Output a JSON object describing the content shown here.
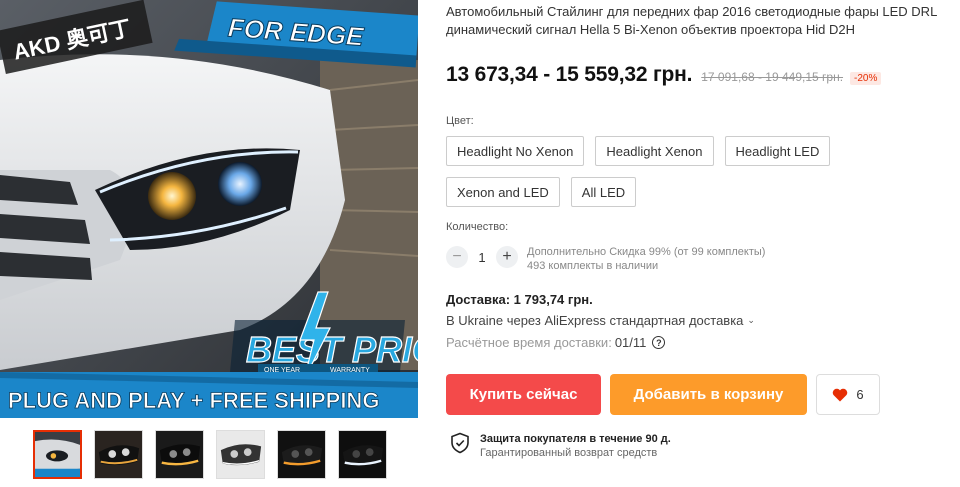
{
  "product": {
    "title": "Автомобильный Стайлинг для передних фар 2016 светодиодные фары LED DRL динамический сигнал Hella 5 Bi-Xenon объектив проектора Hid D2H",
    "price": "13 673,34 - 15 559,32 грн.",
    "old_price": "17 091,68 - 19 449,15 грн.",
    "discount": "-20%"
  },
  "image_banner": {
    "brand_text": "AKD 奥可丁",
    "top_banner": "FOR EDGE",
    "badge_main": "BEST PRICE",
    "badge_sub_left": "ONE YEAR",
    "badge_sub_right": "WARRANTY",
    "bottom_banner_1": "PLUG AND PLAY + FREE SHIPPING"
  },
  "color": {
    "label": "Цвет:",
    "options": [
      "Headlight No Xenon",
      "Headlight Xenon",
      "Headlight LED",
      "Xenon and LED",
      "All LED"
    ]
  },
  "quantity": {
    "label": "Количество:",
    "minus": "−",
    "value": "1",
    "plus": "+",
    "note_line1": "Дополнительно Скидка 99% (от 99 комплекты)",
    "note_line2": "493 комплекты в наличии"
  },
  "shipping": {
    "title": "Доставка: 1 793,74 грн.",
    "via": "В Ukraine через AliExpress стандартная доставка",
    "time_label": "Расчётное время доставки:",
    "time_value": "01/11",
    "help_glyph": "?"
  },
  "actions": {
    "buy_now": "Купить сейчас",
    "add_to_cart": "Добавить в корзину",
    "wish_count": "6"
  },
  "protection": {
    "title": "Защита покупателя в течение 90 д.",
    "subtitle": "Гарантированный возврат средств"
  },
  "thumbnails": [
    "thumb-1",
    "thumb-2",
    "thumb-3",
    "thumb-4",
    "thumb-5",
    "thumb-6"
  ],
  "colors": {
    "buy_now": "#f44a4a",
    "add_to_cart": "#fd9b2a",
    "discount": "#e62e04",
    "heart": "#e62e04"
  },
  "icons": {
    "heart": "heart-icon",
    "shield": "shield-check-icon",
    "chevron": "chevron-down-icon",
    "help": "help-circle-icon"
  }
}
